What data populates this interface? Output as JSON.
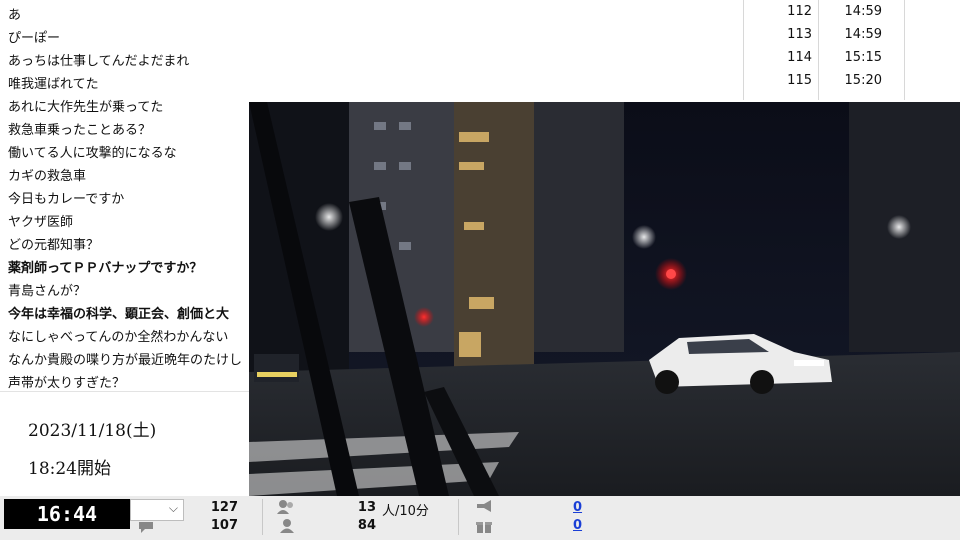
{
  "comments": [
    {
      "text": "あ",
      "num": "112",
      "time": "14:59"
    },
    {
      "text": "ぴーぽー",
      "num": "113",
      "time": "14:59"
    },
    {
      "text": "あっちは仕事してんだよだまれ",
      "num": "114",
      "time": "15:15"
    },
    {
      "text": "唯我運ばれてた",
      "num": "115",
      "time": "15:20"
    },
    {
      "text": "あれに大作先生が乗ってた"
    },
    {
      "text": "救急車乗ったことある？"
    },
    {
      "text": "働いてる人に攻撃的になるな"
    },
    {
      "text": "カギの救急車"
    },
    {
      "text": "今日もカレーですか"
    },
    {
      "text": "ヤクザ医師"
    },
    {
      "text": "どの元都知事？"
    },
    {
      "text": "薬剤師ってＰＰバナップですか？",
      "bold": true
    },
    {
      "text": "青島さんが？"
    },
    {
      "text": "今年は幸福の科学、顕正会、創価と大",
      "bold": true
    },
    {
      "text": "なにしゃべってんのか全然わかんない"
    },
    {
      "text": "なんか貴殿の喋り方が最近晩年のたけし"
    },
    {
      "text": "声帯が太りすぎた？"
    }
  ],
  "info": {
    "date": "2023/11/18(土)",
    "start": "18:24開始"
  },
  "bottom": {
    "clock": "16:44",
    "left_top": "127",
    "left_bottom": "107",
    "mid_top": "13",
    "mid_unit": "人/10分",
    "mid_bottom": "84",
    "right_top": "0",
    "right_bottom": "0",
    "icons": [
      "comment-icon",
      "person-group-icon",
      "person-icon",
      "megaphone-icon",
      "gift-icon"
    ]
  },
  "colors": {
    "clock_bg": "#000000",
    "link": "#1a3fd6",
    "bar_bg": "#ececec"
  }
}
